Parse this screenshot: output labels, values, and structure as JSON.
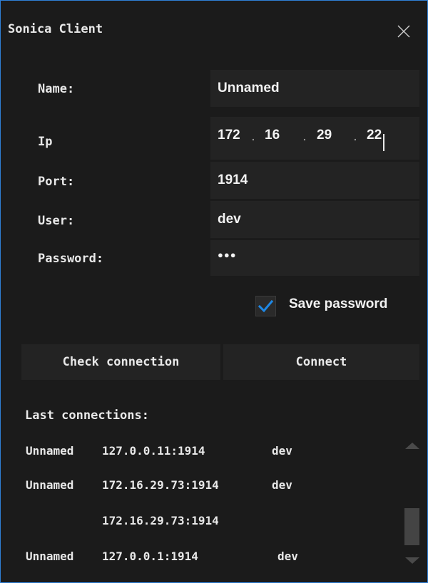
{
  "window": {
    "title": "Sonica Client",
    "close_icon": "close-icon"
  },
  "form": {
    "name_label": "Name:",
    "name_value": "Unnamed",
    "ip_label": "Ip",
    "ip_octets": [
      "172",
      "16",
      "29",
      "22"
    ],
    "ip_separator": ".",
    "port_label": "Port:",
    "port_value": "1914",
    "user_label": "User:",
    "user_value": "dev",
    "password_label": "Password:",
    "password_value": "●●●",
    "save_password_label": "Save password",
    "save_password_checked": true
  },
  "buttons": {
    "check_connection": "Check connection",
    "connect": "Connect"
  },
  "last_connections": {
    "title": "Last connections:",
    "items": [
      {
        "name": "Unnamed",
        "address": "127.0.0.11:1914",
        "user": "dev"
      },
      {
        "name": "Unnamed",
        "address": "172.16.29.73:1914",
        "user": "dev"
      },
      {
        "name": "",
        "address": "172.16.29.73:1914",
        "user": ""
      },
      {
        "name": "Unnamed",
        "address": "127.0.0.1:1914",
        "user": "dev"
      }
    ]
  },
  "colors": {
    "accent": "#2f7fd6",
    "checkbox": "#1e88e5",
    "background": "#1b1b1b",
    "field": "#232323"
  }
}
